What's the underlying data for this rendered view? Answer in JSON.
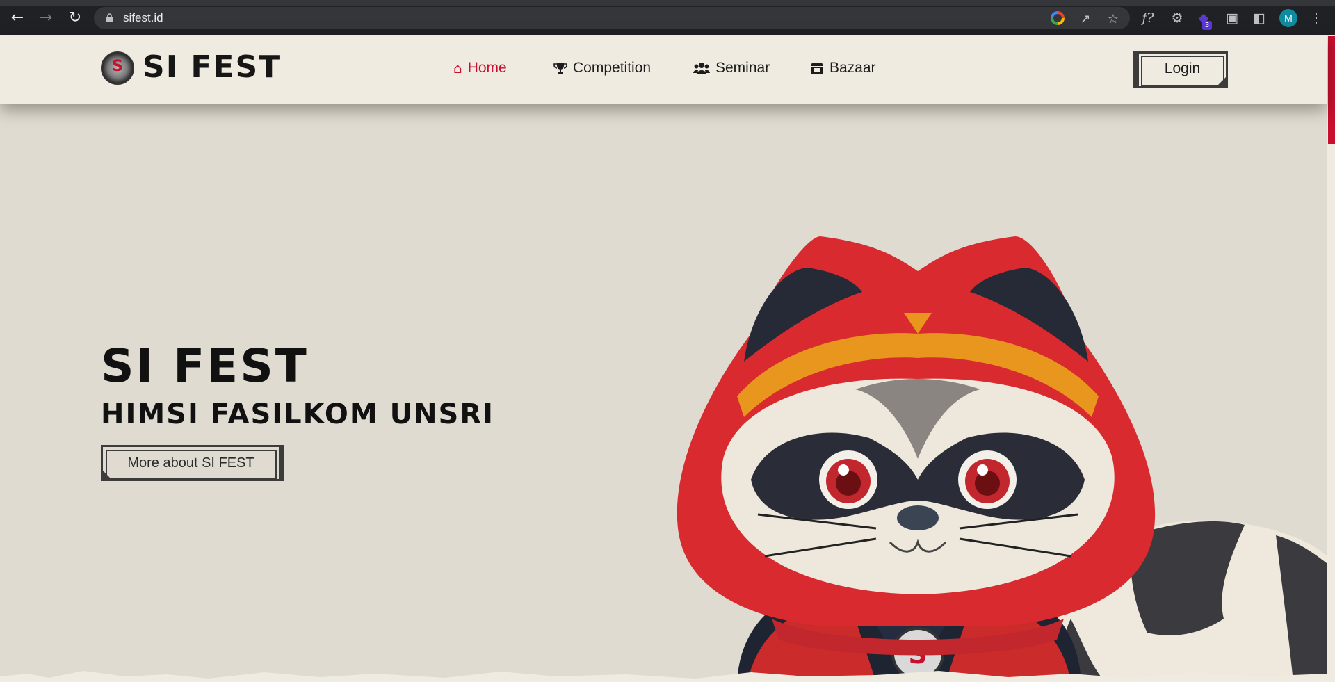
{
  "browser": {
    "url": "sifest.id",
    "extension_badge": "3",
    "profile_initial": "M",
    "icons": [
      "back-icon",
      "forward-icon",
      "reload-icon",
      "lock-icon",
      "google-icon",
      "share-icon",
      "star-icon",
      "function-icon",
      "gear-icon",
      "extension-icon",
      "puzzle-icon",
      "sidepanel-icon",
      "menu-icon"
    ]
  },
  "header": {
    "brand": "SI FEST",
    "nav": [
      {
        "label": "Home",
        "icon": "home-icon",
        "active": true
      },
      {
        "label": "Competition",
        "icon": "trophy-icon",
        "active": false
      },
      {
        "label": "Seminar",
        "icon": "users-icon",
        "active": false
      },
      {
        "label": "Bazaar",
        "icon": "store-icon",
        "active": false
      }
    ],
    "login_label": "Login"
  },
  "hero": {
    "title": "SI FEST",
    "subtitle": "HIMSI FASILKOM UNSRI",
    "cta_label": "More about SI FEST"
  },
  "colors": {
    "accent": "#c8102e",
    "background": "#dfdbd0",
    "header_bg": "#f0ebe1",
    "text": "#111111"
  }
}
